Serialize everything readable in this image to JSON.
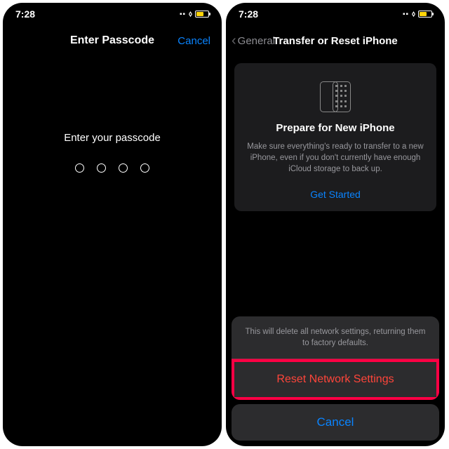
{
  "status": {
    "time": "7:28"
  },
  "left": {
    "title": "Enter Passcode",
    "cancel": "Cancel",
    "prompt": "Enter your passcode"
  },
  "right": {
    "back_label": "General",
    "title": "Transfer or Reset iPhone",
    "card": {
      "title": "Prepare for New iPhone",
      "desc": "Make sure everything's ready to transfer to a new iPhone, even if you don't currently have enough iCloud storage to back up.",
      "link": "Get Started"
    },
    "sheet": {
      "message": "This will delete all network settings, returning them to factory defaults.",
      "action": "Reset Network Settings",
      "cancel": "Cancel"
    }
  }
}
